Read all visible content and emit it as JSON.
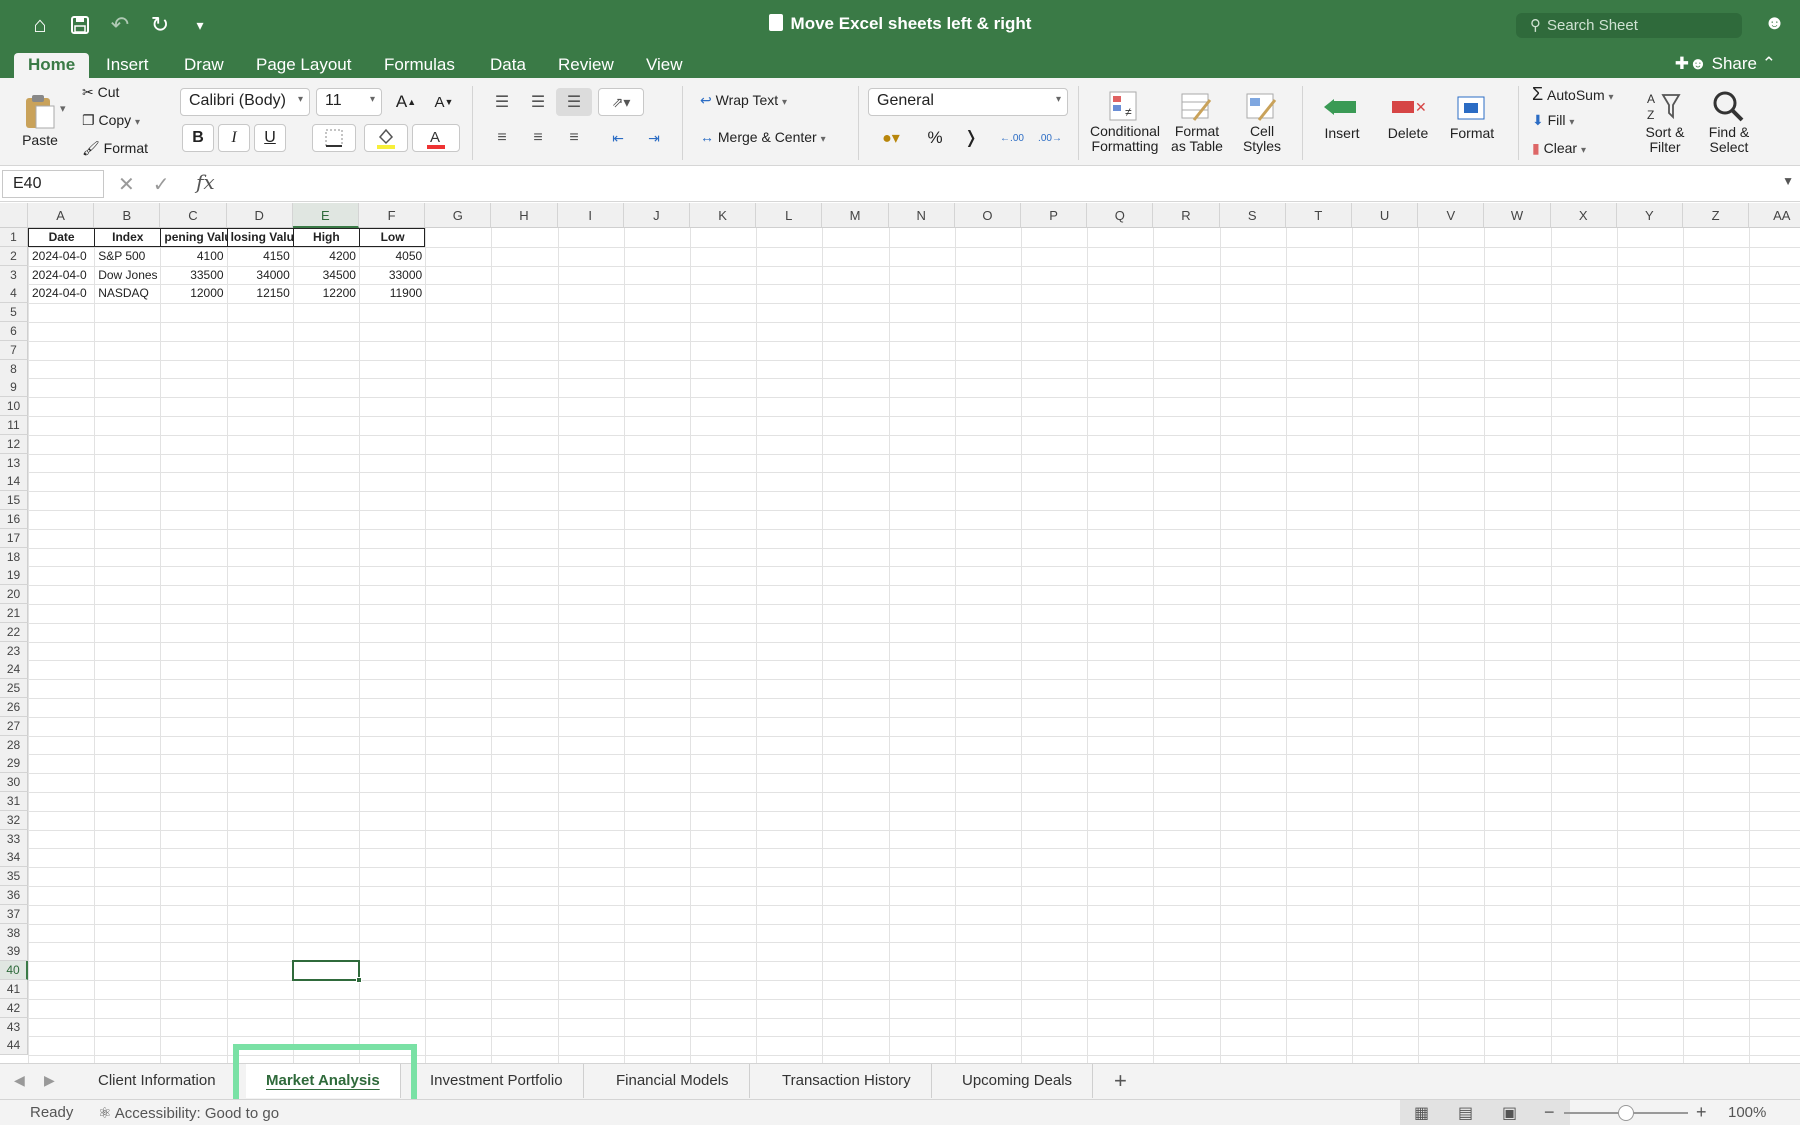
{
  "window": {
    "title": "Move Excel sheets left & right",
    "search_placeholder": "Search Sheet"
  },
  "menu_tabs": [
    "Home",
    "Insert",
    "Draw",
    "Page Layout",
    "Formulas",
    "Data",
    "Review",
    "View"
  ],
  "share_label": "Share",
  "ribbon": {
    "paste": "Paste",
    "cut": "Cut",
    "copy": "Copy",
    "format_painter": "Format",
    "font_name": "Calibri (Body)",
    "font_size": "11",
    "bold": "B",
    "italic": "I",
    "underline": "U",
    "wrap_text": "Wrap Text",
    "merge_center": "Merge & Center",
    "number_format": "General",
    "percent": "%",
    "conditional_formatting": [
      "Conditional",
      "Formatting"
    ],
    "format_as_table": [
      "Format",
      "as Table"
    ],
    "cell_styles": [
      "Cell",
      "Styles"
    ],
    "insert": "Insert",
    "delete": "Delete",
    "format": "Format",
    "autosum": "AutoSum",
    "fill": "Fill",
    "clear": "Clear",
    "sort_filter": [
      "Sort &",
      "Filter"
    ],
    "find_select": [
      "Find &",
      "Select"
    ]
  },
  "formula_bar": {
    "name_box": "E40",
    "fx": "fx",
    "formula": ""
  },
  "selected_cell": {
    "column": "E",
    "row": 40
  },
  "columns": [
    "A",
    "B",
    "C",
    "D",
    "E",
    "F",
    "G",
    "H",
    "I",
    "J",
    "K",
    "L",
    "M",
    "N",
    "O",
    "P",
    "Q",
    "R",
    "S",
    "T",
    "U",
    "V",
    "W",
    "X",
    "Y",
    "Z",
    "AA"
  ],
  "row_count": 44,
  "table": {
    "headers": [
      "Date",
      "Index",
      "pening Valu",
      "losing Valu",
      "High",
      "Low"
    ],
    "rows": [
      [
        "2024-04-0",
        "S&P 500",
        "4100",
        "4150",
        "4200",
        "4050"
      ],
      [
        "2024-04-0",
        "Dow Jones",
        "33500",
        "34000",
        "34500",
        "33000"
      ],
      [
        "2024-04-0",
        "NASDAQ",
        "12000",
        "12150",
        "12200",
        "11900"
      ]
    ]
  },
  "sheet_tabs": [
    "Client Information",
    "Market Analysis",
    "Investment Portfolio",
    "Financial Models",
    "Transaction History",
    "Upcoming Deals"
  ],
  "active_sheet": "Market Analysis",
  "status": {
    "ready": "Ready",
    "accessibility": "Accessibility: Good to go",
    "zoom": "100%"
  },
  "colors": {
    "accent": "#3a7a46",
    "highlight": "#7ae1a5"
  }
}
